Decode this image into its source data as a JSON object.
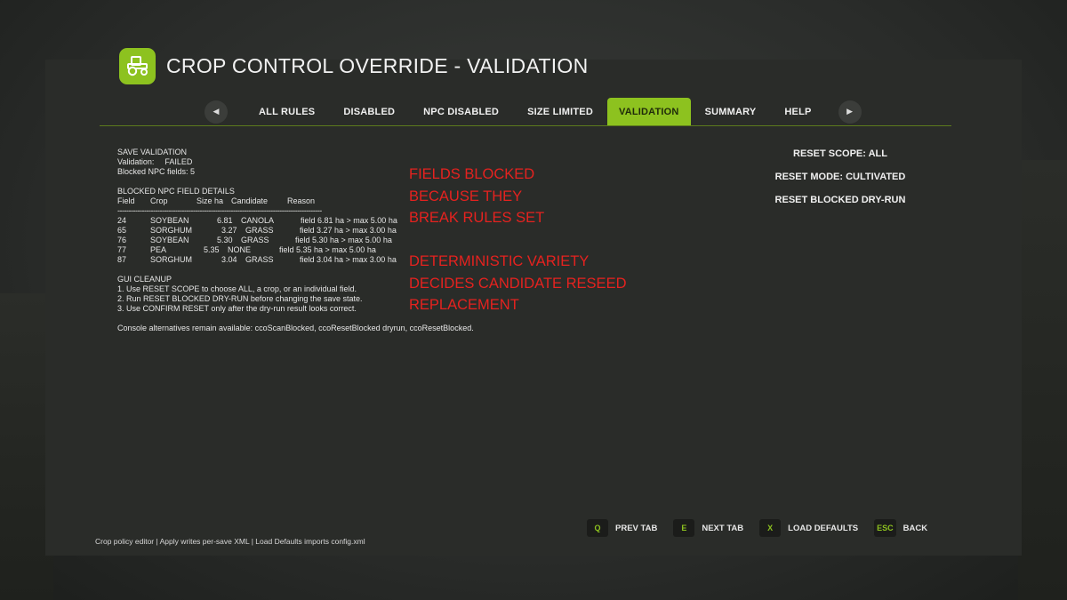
{
  "header": {
    "title": "CROP CONTROL OVERRIDE - VALIDATION",
    "icon": "tractor-icon",
    "accent": "#8dc21f"
  },
  "tabs": [
    {
      "label": "ALL RULES",
      "active": false
    },
    {
      "label": "DISABLED",
      "active": false
    },
    {
      "label": "NPC DISABLED",
      "active": false
    },
    {
      "label": "SIZE LIMITED",
      "active": false
    },
    {
      "label": "VALIDATION",
      "active": true
    },
    {
      "label": "SUMMARY",
      "active": false
    },
    {
      "label": "HELP",
      "active": false
    }
  ],
  "report": {
    "section_title": "SAVE VALIDATION",
    "validation_label": "Validation:",
    "validation_value": "FAILED",
    "blocked_count": "Blocked NPC fields: 5",
    "details_title": "BLOCKED NPC FIELD DETAILS",
    "columns": [
      "Field",
      "Crop",
      "Size ha",
      "Candidate",
      "Reason"
    ],
    "separator": "--------------------------------------------------------------------------------------------",
    "rows": [
      {
        "field": "24",
        "crop": "SOYBEAN",
        "size": "6.81",
        "candidate": "CANOLA",
        "reason": "field 6.81 ha > max 5.00 ha"
      },
      {
        "field": "65",
        "crop": "SORGHUM",
        "size": "3.27",
        "candidate": "GRASS",
        "reason": "field 3.27 ha > max 3.00 ha"
      },
      {
        "field": "76",
        "crop": "SOYBEAN",
        "size": "5.30",
        "candidate": "GRASS",
        "reason": "field 5.30 ha > max 5.00 ha"
      },
      {
        "field": "77",
        "crop": "PEA",
        "size": "5.35",
        "candidate": "NONE",
        "reason": "field 5.35 ha > max 5.00 ha"
      },
      {
        "field": "87",
        "crop": "SORGHUM",
        "size": "3.04",
        "candidate": "GRASS",
        "reason": "field 3.04 ha > max 3.00 ha"
      }
    ],
    "cleanup_title": "GUI CLEANUP",
    "cleanup_steps": [
      "1. Use RESET SCOPE to choose ALL, a crop, or an individual field.",
      "2. Run RESET BLOCKED DRY-RUN before changing the save state.",
      "3. Use CONFIRM RESET only after the dry-run result looks correct."
    ],
    "console_note": "Console alternatives remain available: ccoScanBlocked, ccoResetBlocked dryrun, ccoResetBlocked."
  },
  "annotations": {
    "color": "#e5221f",
    "first": [
      "FIELDS BLOCKED",
      "BECAUSE THEY",
      "BREAK RULES SET"
    ],
    "second": [
      "DETERMINISTIC VARIETY",
      "DECIDES CANDIDATE RESEED",
      "REPLACEMENT"
    ]
  },
  "actions": {
    "reset_scope": "RESET SCOPE: ALL",
    "reset_mode": "RESET MODE: CULTIVATED",
    "reset_dry_run": "RESET BLOCKED DRY-RUN"
  },
  "footer": {
    "note": "Crop policy editor | Apply writes per-save XML | Load Defaults imports config.xml",
    "hotkeys": [
      {
        "key": "Q",
        "label": "PREV TAB"
      },
      {
        "key": "E",
        "label": "NEXT TAB"
      },
      {
        "key": "X",
        "label": "LOAD DEFAULTS"
      },
      {
        "key": "ESC",
        "label": "BACK"
      }
    ]
  }
}
